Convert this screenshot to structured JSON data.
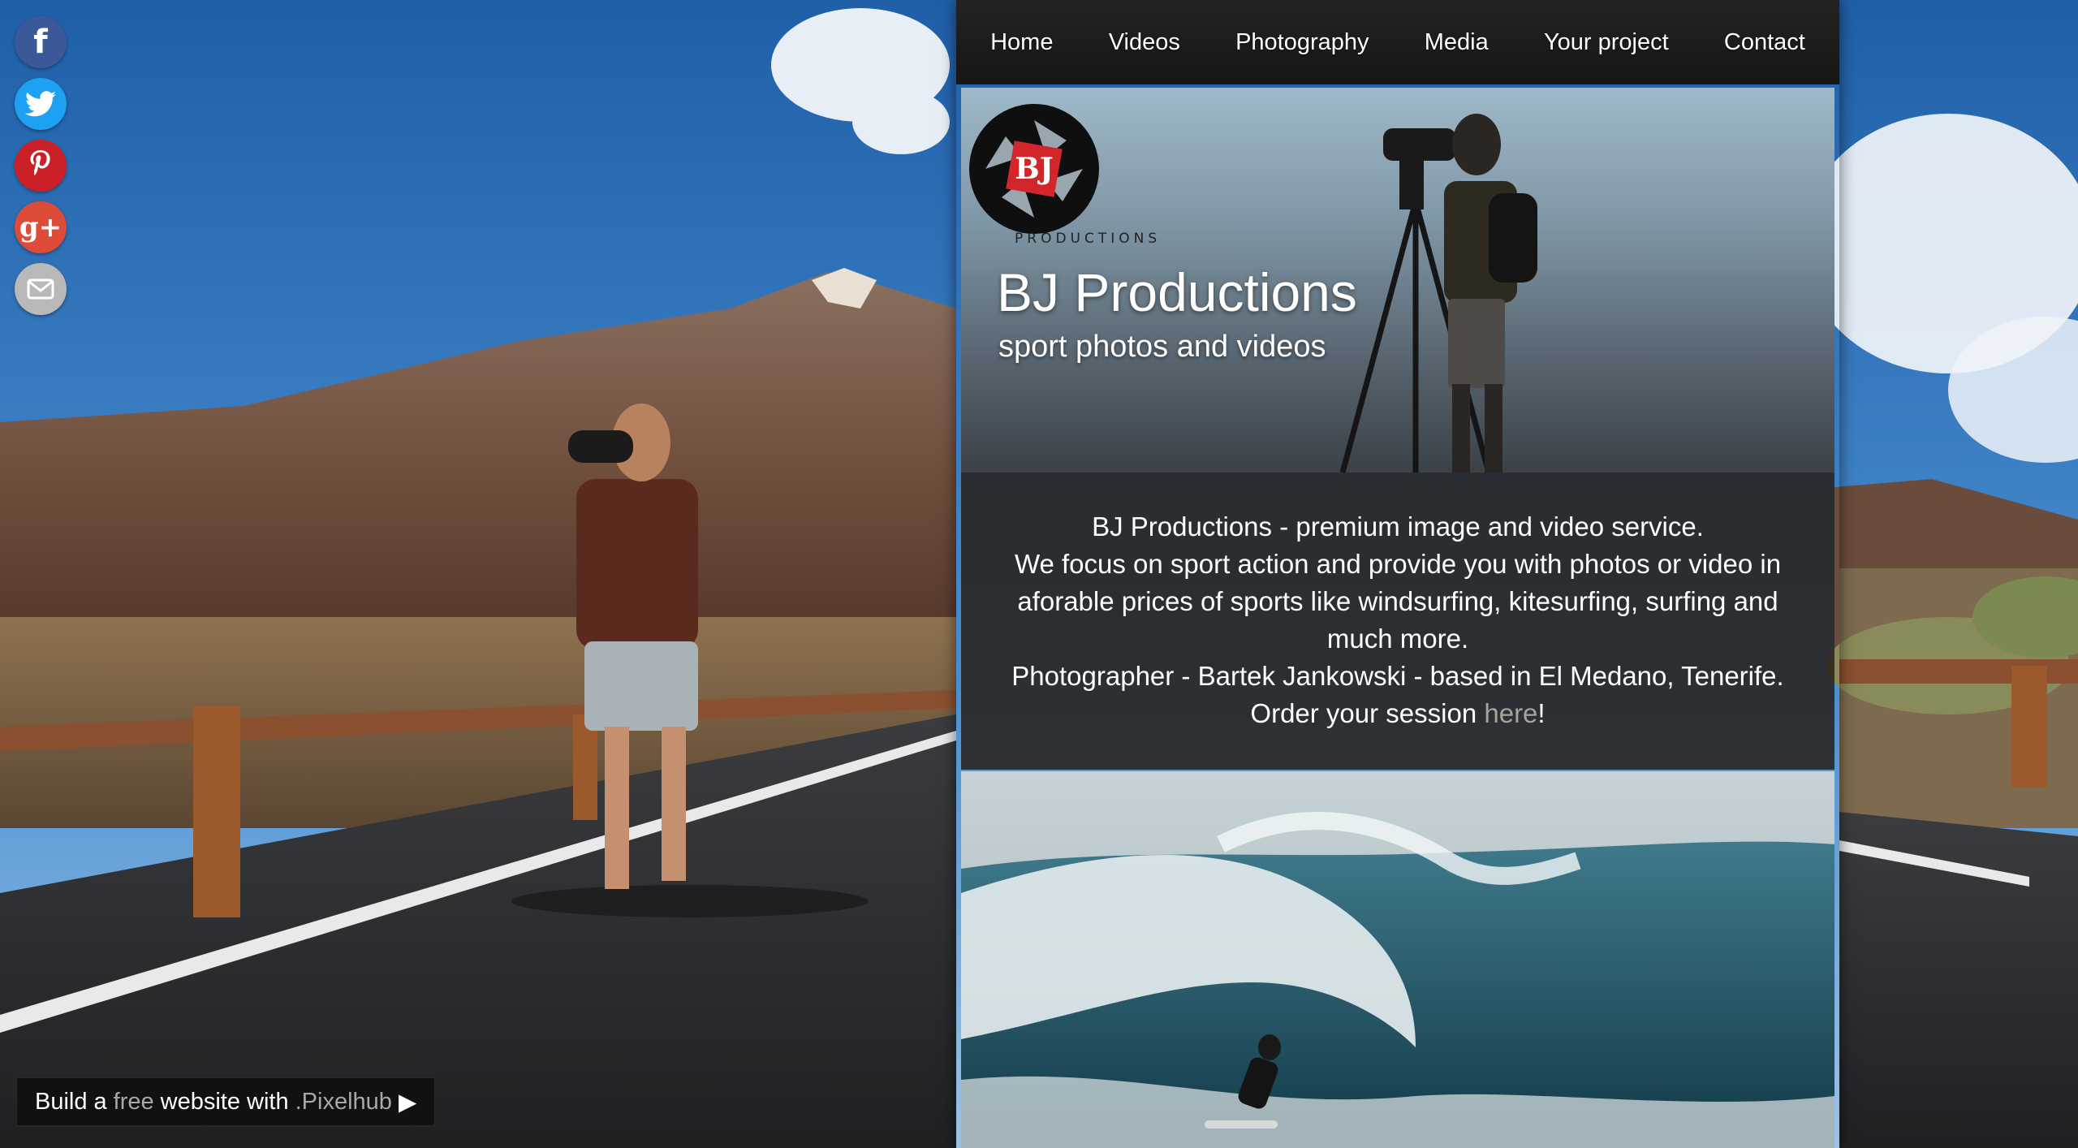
{
  "social": {
    "items": [
      {
        "name": "facebook",
        "icon": "facebook-icon",
        "glyph": "f",
        "color": "#3b5998"
      },
      {
        "name": "twitter",
        "icon": "twitter-bird-icon",
        "color": "#1da1f2"
      },
      {
        "name": "pinterest",
        "icon": "pinterest-icon",
        "color": "#cb2027"
      },
      {
        "name": "google-plus",
        "icon": "google-plus-icon",
        "glyph": "g+",
        "color": "#dd4b39"
      },
      {
        "name": "email",
        "icon": "envelope-icon",
        "color": "#b9b9b9"
      }
    ]
  },
  "nav": {
    "items": [
      "Home",
      "Videos",
      "Photography",
      "Media",
      "Your project",
      "Contact"
    ]
  },
  "hero": {
    "logo_text": "PRODUCTIONS",
    "logo_mark": "BJ",
    "title": "BJ Productions",
    "subtitle": "sport photos and videos"
  },
  "intro": {
    "line1": "BJ Productions - premium image and video service.",
    "line2": "We focus on sport action and provide you with photos or video in aforable prices of sports like windsurfing, kitesurfing, surfing and much more.",
    "line3": "Photographer - Bartek Jankowski - based in El Medano, Tenerife.",
    "line4_prefix": "Order your session ",
    "line4_link": "here",
    "line4_suffix": "!"
  },
  "banner": {
    "part1": "Build a",
    "part2": "free",
    "part3": "website with",
    "part4": ".Pixelhub",
    "arrow": "▶"
  },
  "colors": {
    "nav_bg": "#1c1b19",
    "intro_bg": "#261d16",
    "link": "#a7a39c"
  }
}
